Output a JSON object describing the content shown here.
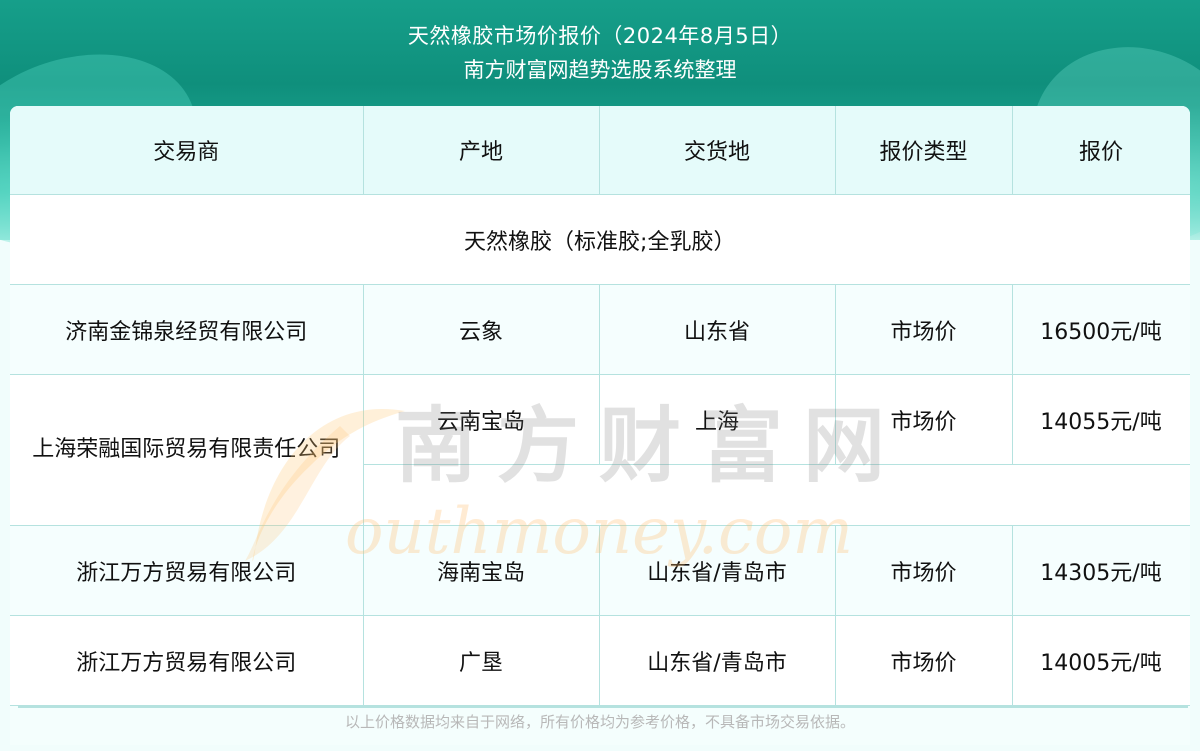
{
  "header": {
    "title": "天然橡胶市场价报价（2024年8月5日）",
    "subtitle": "南方财富网趋势选股系统整理"
  },
  "table": {
    "columns": [
      "交易商",
      "产地",
      "交货地",
      "报价类型",
      "报价"
    ],
    "category": "天然橡胶（标准胶;全乳胶）",
    "rows": [
      {
        "trader": "济南金锦泉经贸有限公司",
        "origin": "云象",
        "delivery": "山东省",
        "quote_type": "市场价",
        "price": "16500元/吨"
      },
      {
        "trader": "上海荣融国际贸易有限责任公司",
        "origin": "云南宝岛",
        "delivery": "上海",
        "quote_type": "市场价",
        "price": "14055元/吨"
      },
      {
        "trader": "浙江万方贸易有限公司",
        "origin": "海南宝岛",
        "delivery": "山东省/青岛市",
        "quote_type": "市场价",
        "price": "14305元/吨"
      },
      {
        "trader": "浙江万方贸易有限公司",
        "origin": "广垦",
        "delivery": "山东省/青岛市",
        "quote_type": "市场价",
        "price": "14005元/吨"
      }
    ]
  },
  "watermark": {
    "cn": "南方财富网",
    "en": "outhmoney.com",
    "logo_letter": "S"
  },
  "footer": {
    "disclaimer": "以上价格数据均来自于网络，所有价格均为参考价格，不具备市场交易依据。"
  },
  "colors": {
    "header_green": "#169f8a",
    "grid_line": "#b5e2df",
    "header_row_bg": "#e5fbfa"
  }
}
